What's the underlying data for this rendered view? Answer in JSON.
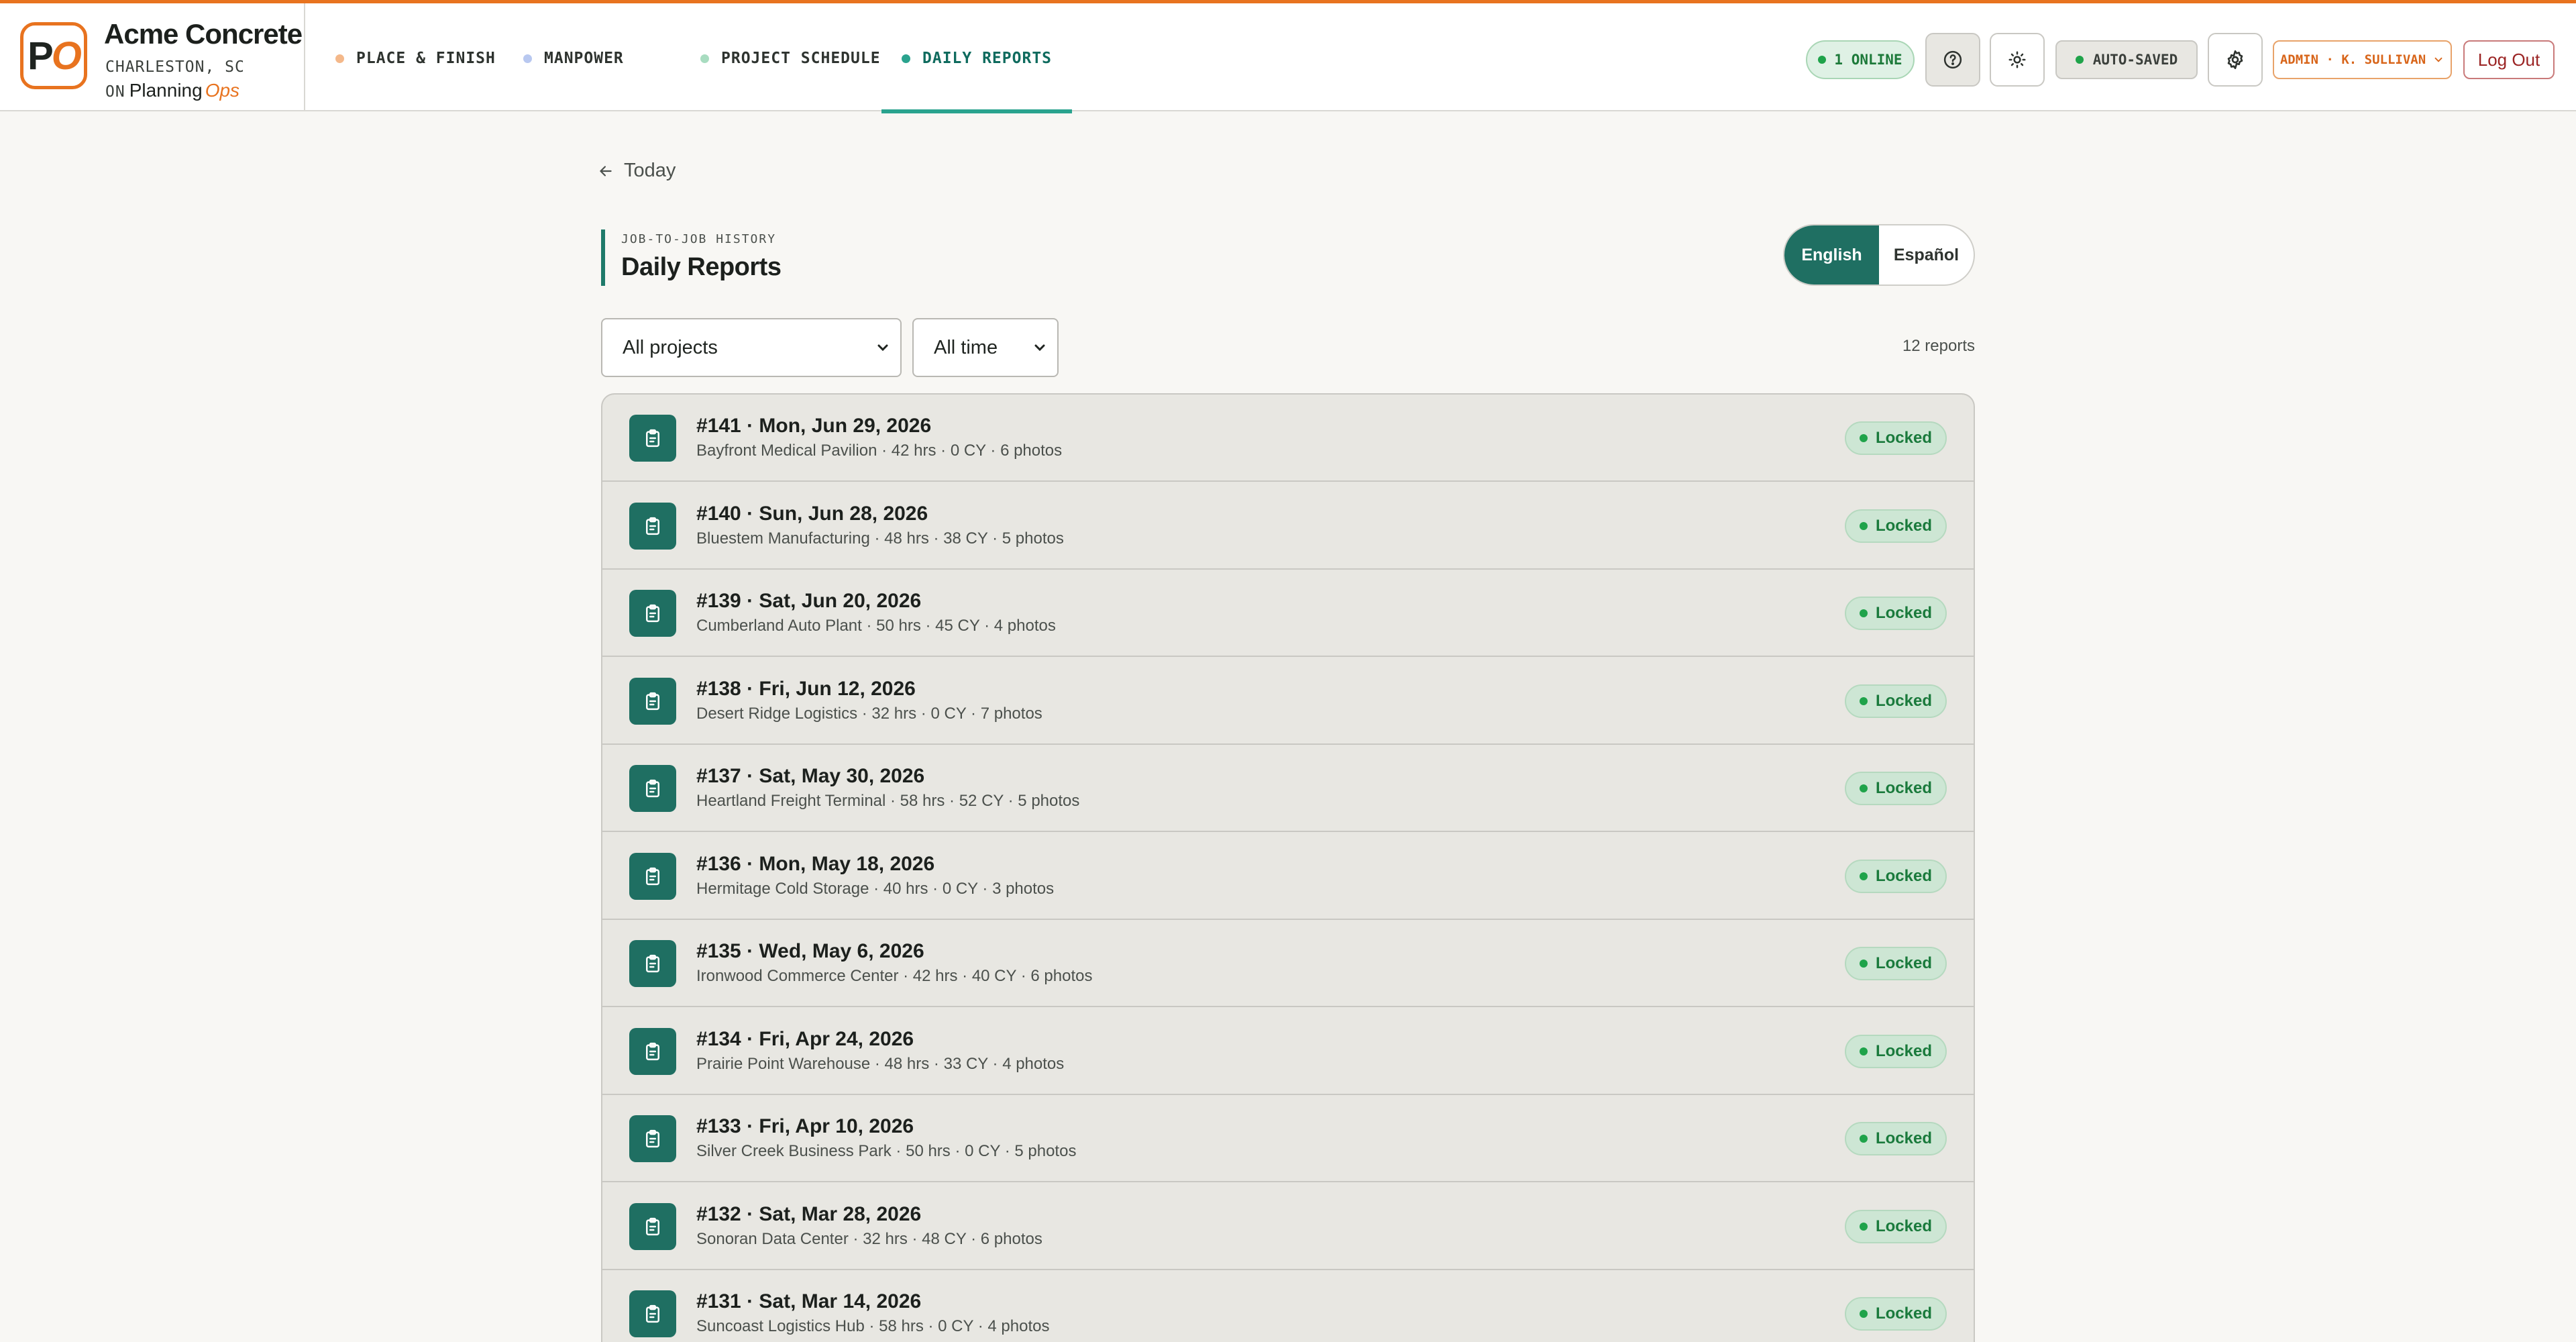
{
  "brand": {
    "logo_p": "P",
    "logo_o": "O",
    "name": "Acme Concrete",
    "location": "CHARLESTON, SC",
    "on": "ON",
    "planning": "Planning",
    "ops": "Ops"
  },
  "nav": [
    {
      "label": "PLACE & FINISH",
      "dot": "#f4b88a"
    },
    {
      "label": "MANPOWER",
      "dot": "#b8c8f0"
    },
    {
      "label": "PROJECT SCHEDULE",
      "dot": "#a8dcc0"
    },
    {
      "label": "DAILY REPORTS",
      "dot": "#2aa38e",
      "active": true
    }
  ],
  "header": {
    "online": "1 ONLINE",
    "help_icon": "help-circle-icon",
    "theme_icon": "sun-icon",
    "autosaved": "AUTO-SAVED",
    "settings_icon": "gear-icon",
    "admin": "ADMIN · K. SULLIVAN",
    "logout": "Log Out"
  },
  "page": {
    "back": "Today",
    "eyebrow": "JOB-TO-JOB HISTORY",
    "title": "Daily Reports",
    "lang_en": "English",
    "lang_es": "Español",
    "filter_project": "All projects",
    "filter_time": "All time",
    "count": "12 reports"
  },
  "colors": {
    "accent": "#e8731f",
    "primary": "#1f6f62",
    "locked": "#1a7a3c"
  },
  "reports": [
    {
      "title": "#141 · Mon, Jun 29, 2026",
      "sub": "Bayfront Medical Pavilion · 42 hrs · 0 CY · 6 photos",
      "status": "Locked"
    },
    {
      "title": "#140 · Sun, Jun 28, 2026",
      "sub": "Bluestem Manufacturing · 48 hrs · 38 CY · 5 photos",
      "status": "Locked"
    },
    {
      "title": "#139 · Sat, Jun 20, 2026",
      "sub": "Cumberland Auto Plant · 50 hrs · 45 CY · 4 photos",
      "status": "Locked"
    },
    {
      "title": "#138 · Fri, Jun 12, 2026",
      "sub": "Desert Ridge Logistics · 32 hrs · 0 CY · 7 photos",
      "status": "Locked"
    },
    {
      "title": "#137 · Sat, May 30, 2026",
      "sub": "Heartland Freight Terminal · 58 hrs · 52 CY · 5 photos",
      "status": "Locked"
    },
    {
      "title": "#136 · Mon, May 18, 2026",
      "sub": "Hermitage Cold Storage · 40 hrs · 0 CY · 3 photos",
      "status": "Locked"
    },
    {
      "title": "#135 · Wed, May 6, 2026",
      "sub": "Ironwood Commerce Center · 42 hrs · 40 CY · 6 photos",
      "status": "Locked"
    },
    {
      "title": "#134 · Fri, Apr 24, 2026",
      "sub": "Prairie Point Warehouse · 48 hrs · 33 CY · 4 photos",
      "status": "Locked"
    },
    {
      "title": "#133 · Fri, Apr 10, 2026",
      "sub": "Silver Creek Business Park · 50 hrs · 0 CY · 5 photos",
      "status": "Locked"
    },
    {
      "title": "#132 · Sat, Mar 28, 2026",
      "sub": "Sonoran Data Center · 32 hrs · 48 CY · 6 photos",
      "status": "Locked"
    },
    {
      "title": "#131 · Sat, Mar 14, 2026",
      "sub": "Suncoast Logistics Hub · 58 hrs · 0 CY · 4 photos",
      "status": "Locked"
    }
  ]
}
